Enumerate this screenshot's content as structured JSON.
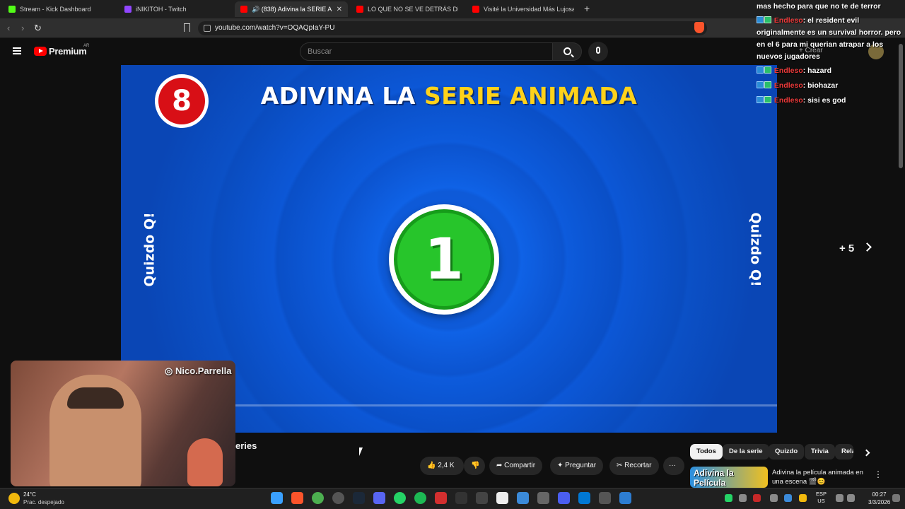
{
  "browser": {
    "tabs": [
      {
        "label": "Stream - Kick Dashboard",
        "color": "#53fc18"
      },
      {
        "label": "iNIKITOH - Twitch",
        "color": "#9146ff"
      },
      {
        "label": "🔊 (838) Adivina la SERIE ANIMA",
        "color": "#ff0000"
      },
      {
        "label": "LO QUE NO SE VE DETRÁS DE PEAKY",
        "color": "#ff0000"
      },
      {
        "label": "Visité la Universidad Más Lujosa de E",
        "color": "#ff0000"
      }
    ],
    "new_tab": "+",
    "url": "youtube.com/watch?v=OQAQpIaY-PU"
  },
  "youtube": {
    "logo_text": "Premium",
    "region": "AR",
    "search_placeholder": "Buscar",
    "create_label": "+ Crear"
  },
  "video": {
    "title_white": "ADIVINA LA ",
    "title_yellow": "SERIE ANIMADA",
    "question_number": "8",
    "watermark": "Quizdo Q!",
    "countdown": "1",
    "skip_label": "+ 5",
    "name_fragment": "eries"
  },
  "actions": {
    "likes": "2,4 K",
    "share": "Compartir",
    "ask": "Preguntar",
    "clip": "Recortar",
    "more": "···"
  },
  "chips": [
    "Todos",
    "De la serie",
    "Quizdo",
    "Trivia",
    "Rela"
  ],
  "recommended": {
    "thumb_text": "Adivina la Película",
    "title": "Adivina la película animada en una escena 🎬😊"
  },
  "chat": {
    "lines": [
      {
        "user": "",
        "text": "mas hecho para que no te de terror"
      },
      {
        "user": "Endleso",
        "text": ": el resident evil originalmente es un survival horror. pero en el 6 para mi querian atrapar a los nuevos jugadores"
      },
      {
        "user": "Endleso",
        "text": ": hazard"
      },
      {
        "user": "Endleso",
        "text": ": biohazar"
      },
      {
        "user": "Endleso",
        "text": ": sisi es god"
      }
    ]
  },
  "webcam": {
    "instagram_handle": "Nico.Parrella"
  },
  "taskbar": {
    "temperature": "24°C",
    "weather": "Prac. despejado",
    "lang_top": "ESP",
    "lang_bottom": "US",
    "time": "00:27",
    "date": "3/3/2026"
  }
}
